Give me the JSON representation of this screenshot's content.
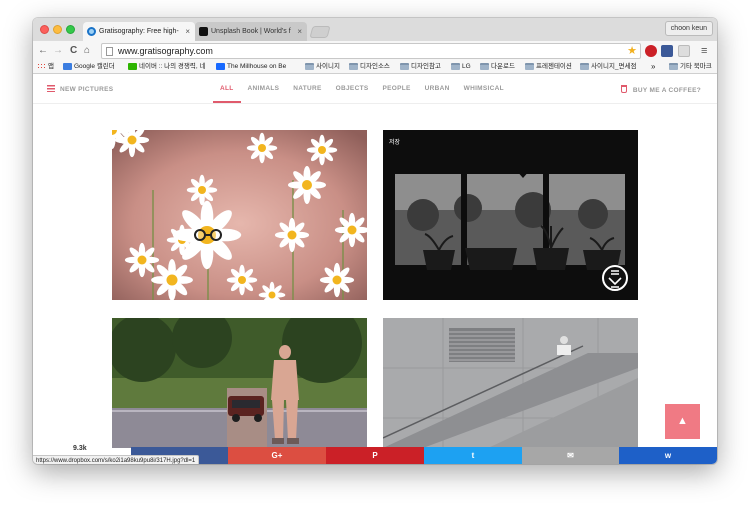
{
  "browser": {
    "tabs": [
      {
        "title": "Gratisography: Free high-r",
        "close": "×"
      },
      {
        "title": "Unsplash Book | World's fir",
        "close": "×"
      }
    ],
    "profile": "choon keun",
    "nav": {
      "back": "←",
      "forward": "→",
      "reload": "C",
      "home": "⌂"
    },
    "url": "www.gratisography.com",
    "star": "★",
    "status_url": "https://www.dropbox.com/s/ko2i1a98ku9pu8i/317H.jpg?dl=1"
  },
  "bookmarks": [
    {
      "label": "앱",
      "icon": "apps-icon",
      "color": "#e0463a"
    },
    {
      "label": "Google 캘린더",
      "icon": "calendar-icon",
      "color": "#3b7de0"
    },
    {
      "label": "네이버 :: 나의 경쟁력, 네",
      "icon": "naver-icon",
      "color": "#2db400"
    },
    {
      "label": "The Millhouse on Be",
      "icon": "behance-icon",
      "color": "#1769ff"
    },
    {
      "label": "사이니지",
      "icon": "folder-icon"
    },
    {
      "label": "디자인소스",
      "icon": "folder-icon"
    },
    {
      "label": "디자인참고",
      "icon": "folder-icon"
    },
    {
      "label": "LG",
      "icon": "folder-icon"
    },
    {
      "label": "다운로드",
      "icon": "folder-icon"
    },
    {
      "label": "프레젠테이션",
      "icon": "folder-icon"
    },
    {
      "label": "사이니지_면세점",
      "icon": "folder-icon"
    },
    {
      "label": "»",
      "icon": ""
    },
    {
      "label": "기타 북마크",
      "icon": "folder-icon"
    }
  ],
  "site": {
    "new_pictures": "NEW PICTURES",
    "buy_coffee": "BUY ME A COFFEE?",
    "categories": [
      "ALL",
      "ANIMALS",
      "NATURE",
      "OBJECTS",
      "PEOPLE",
      "URBAN",
      "WHIMSICAL"
    ],
    "active_category": "ALL",
    "accent_color": "#e05a6c"
  },
  "gallery": {
    "save_label": "저장",
    "scroll_top": "▲"
  },
  "share": {
    "count": "9.3k",
    "buttons": [
      {
        "label": "G+",
        "color": "#dc4e41",
        "icon": "google-plus-icon"
      },
      {
        "label": "P",
        "color": "#cb2027",
        "icon": "pinterest-icon"
      },
      {
        "label": "t",
        "color": "#1da1f2",
        "icon": "twitter-icon"
      },
      {
        "label": "✉",
        "color": "#a7a7a7",
        "icon": "email-icon"
      },
      {
        "label": "w",
        "color": "#1e60c8",
        "icon": "sumome-icon"
      }
    ]
  }
}
